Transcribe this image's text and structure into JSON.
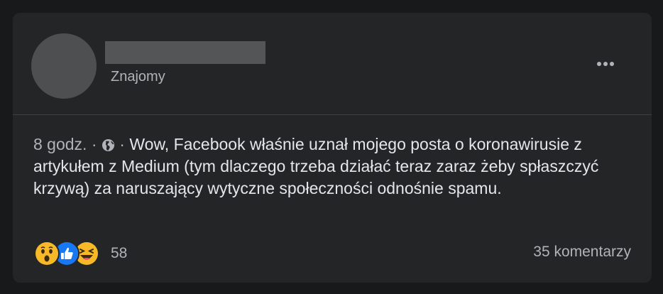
{
  "post": {
    "author_label": "Znajomy",
    "time": "8 godz.",
    "separator": "·",
    "privacy_icon": "globe-icon",
    "text": "Wow, Facebook właśnie uznał mojego posta o koronawirusie z artykułem z Medium (tym dlaczego trzeba działać teraz zaraz żeby spłaszczyć krzywą) za naruszający wytyczne społeczności odnośnie spamu."
  },
  "reactions": {
    "icons": [
      "wow-icon",
      "like-icon",
      "haha-icon"
    ],
    "count": "58"
  },
  "comments_label": "35 komentarzy",
  "colors": {
    "background": "#18191a",
    "card": "#242526",
    "text": "#e4e6eb",
    "secondary_text": "#b0b3b8",
    "like_blue": "#1877f2",
    "emoji_yellow": "#f7b928"
  }
}
